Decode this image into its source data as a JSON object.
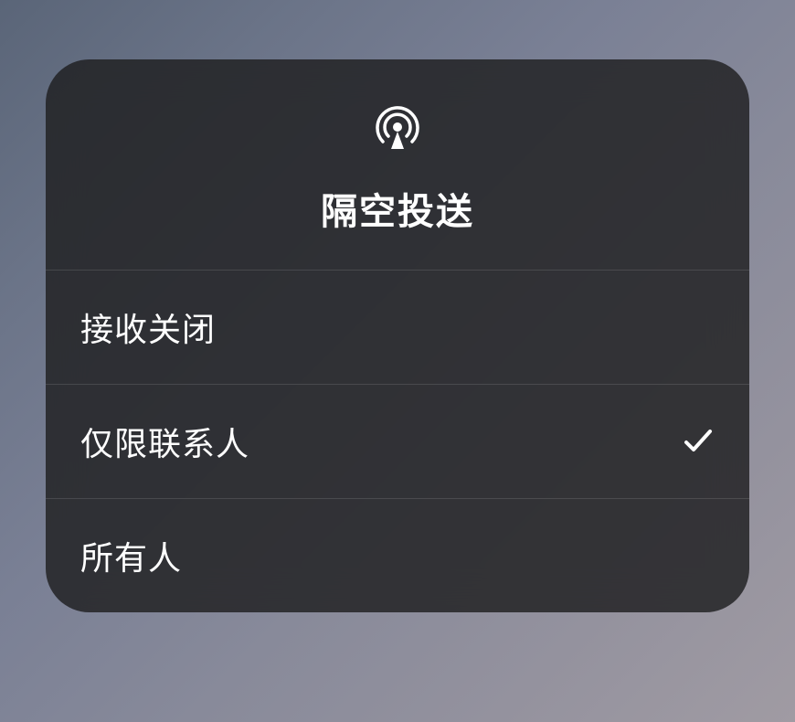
{
  "header": {
    "title": "隔空投送"
  },
  "options": [
    {
      "label": "接收关闭",
      "selected": false
    },
    {
      "label": "仅限联系人",
      "selected": true
    },
    {
      "label": "所有人",
      "selected": false
    }
  ]
}
